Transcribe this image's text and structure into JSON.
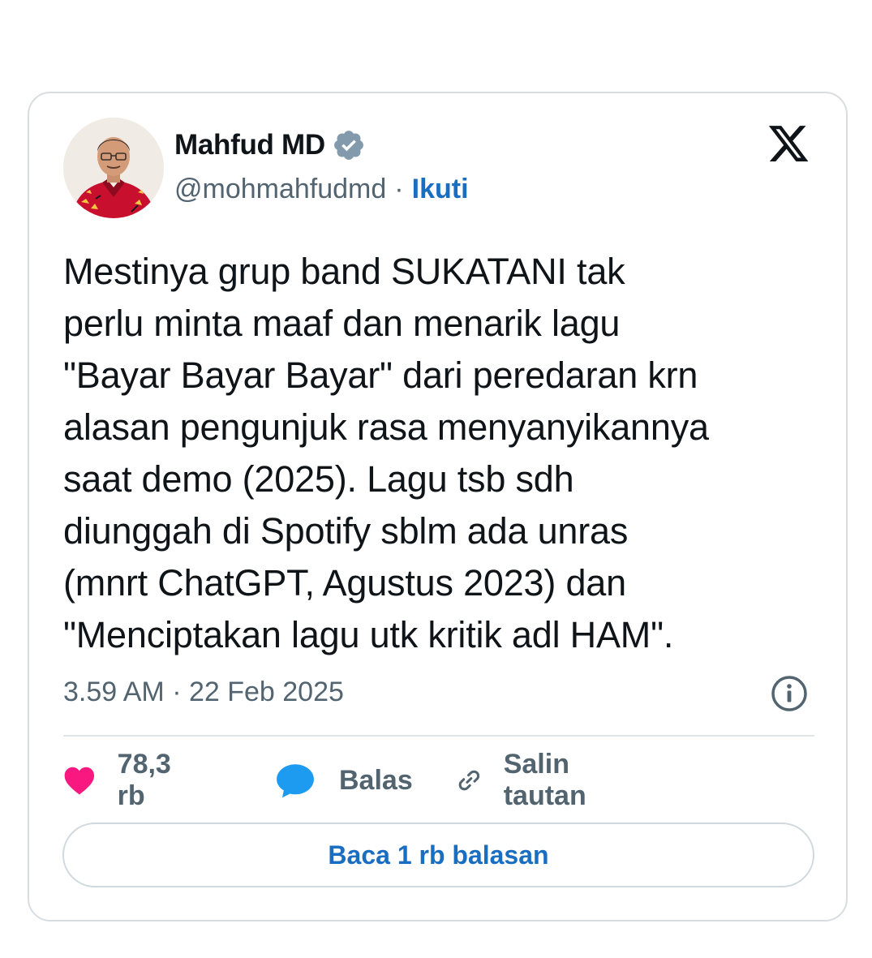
{
  "author": {
    "name": "Mahfud MD",
    "handle": "@mohmahfudmd",
    "separator": "·",
    "follow_label": "Ikuti",
    "avatar_icon": "profile-photo",
    "verified_icon": "verified-badge-icon"
  },
  "brand": {
    "logo_icon": "x-logo-icon"
  },
  "tweet": {
    "text": "Mestinya grup band SUKATANI tak\nperlu minta maaf dan menarik lagu\n\"Bayar Bayar Bayar\" dari peredaran krn\nalasan pengunjuk rasa menyanyikannya\nsaat demo (2025). Lagu tsb sdh\ndiunggah di Spotify sblm ada unras\n(mnrt ChatGPT, Agustus 2023) dan\n\"Menciptakan lagu utk kritik adl HAM\".",
    "timestamp": "3.59 AM · 22 Feb 2025"
  },
  "actions": {
    "likes_count": "78,3 rb",
    "reply_label": "Balas",
    "copy_link_label": "Salin tautan"
  },
  "read_replies_label": "Baca 1 rb balasan",
  "colors": {
    "heart": "#f91880",
    "reply_bubble": "#1d9bf0",
    "link_blue": "#1a6ec1",
    "muted_text": "#536471",
    "verified_badge": "#829aab"
  }
}
